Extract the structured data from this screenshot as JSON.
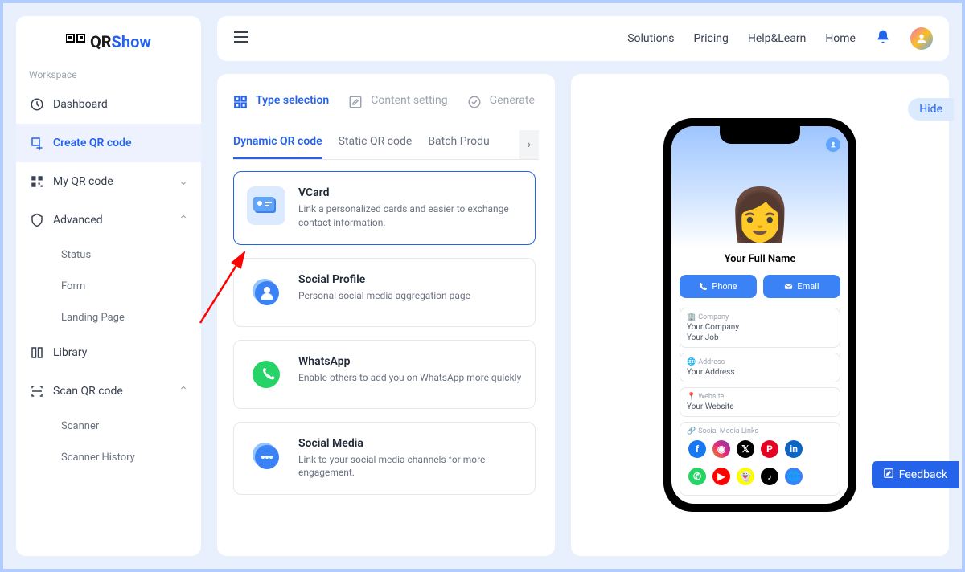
{
  "brand": {
    "prefix": "QR",
    "suffix": "Show"
  },
  "sidebar": {
    "workspace_label": "Workspace",
    "items": [
      {
        "label": "Dashboard"
      },
      {
        "label": "Create QR code"
      },
      {
        "label": "My QR code"
      },
      {
        "label": "Advanced"
      },
      {
        "label": "Library"
      },
      {
        "label": "Scan QR code"
      }
    ],
    "advanced_sub": [
      {
        "label": "Status"
      },
      {
        "label": "Form"
      },
      {
        "label": "Landing Page"
      }
    ],
    "scan_sub": [
      {
        "label": "Scanner"
      },
      {
        "label": "Scanner History"
      }
    ]
  },
  "topbar": {
    "links": [
      {
        "label": "Solutions"
      },
      {
        "label": "Pricing"
      },
      {
        "label": "Help&Learn"
      },
      {
        "label": "Home"
      }
    ]
  },
  "steps": [
    {
      "label": "Type selection"
    },
    {
      "label": "Content setting"
    },
    {
      "label": "Generate"
    }
  ],
  "tabs": [
    {
      "label": "Dynamic QR code"
    },
    {
      "label": "Static QR code"
    },
    {
      "label": "Batch Produ"
    }
  ],
  "types": [
    {
      "title": "VCard",
      "desc": "Link a personalized cards and easier to exchange contact information."
    },
    {
      "title": "Social Profile",
      "desc": "Personal social media aggregation page"
    },
    {
      "title": "WhatsApp",
      "desc": "Enable others to add you on WhatsApp more quickly"
    },
    {
      "title": "Social Media",
      "desc": "Link to your social media channels for more engagement."
    }
  ],
  "preview": {
    "hide": "Hide",
    "name": "Your Full Name",
    "phone": "Phone",
    "email": "Email",
    "company_label": "Company",
    "company": "Your Company",
    "job": "Your Job",
    "address_label": "Address",
    "address": "Your Address",
    "website_label": "Website",
    "website": "Your Website",
    "social_label": "Social Media Links"
  },
  "feedback": "Feedback"
}
